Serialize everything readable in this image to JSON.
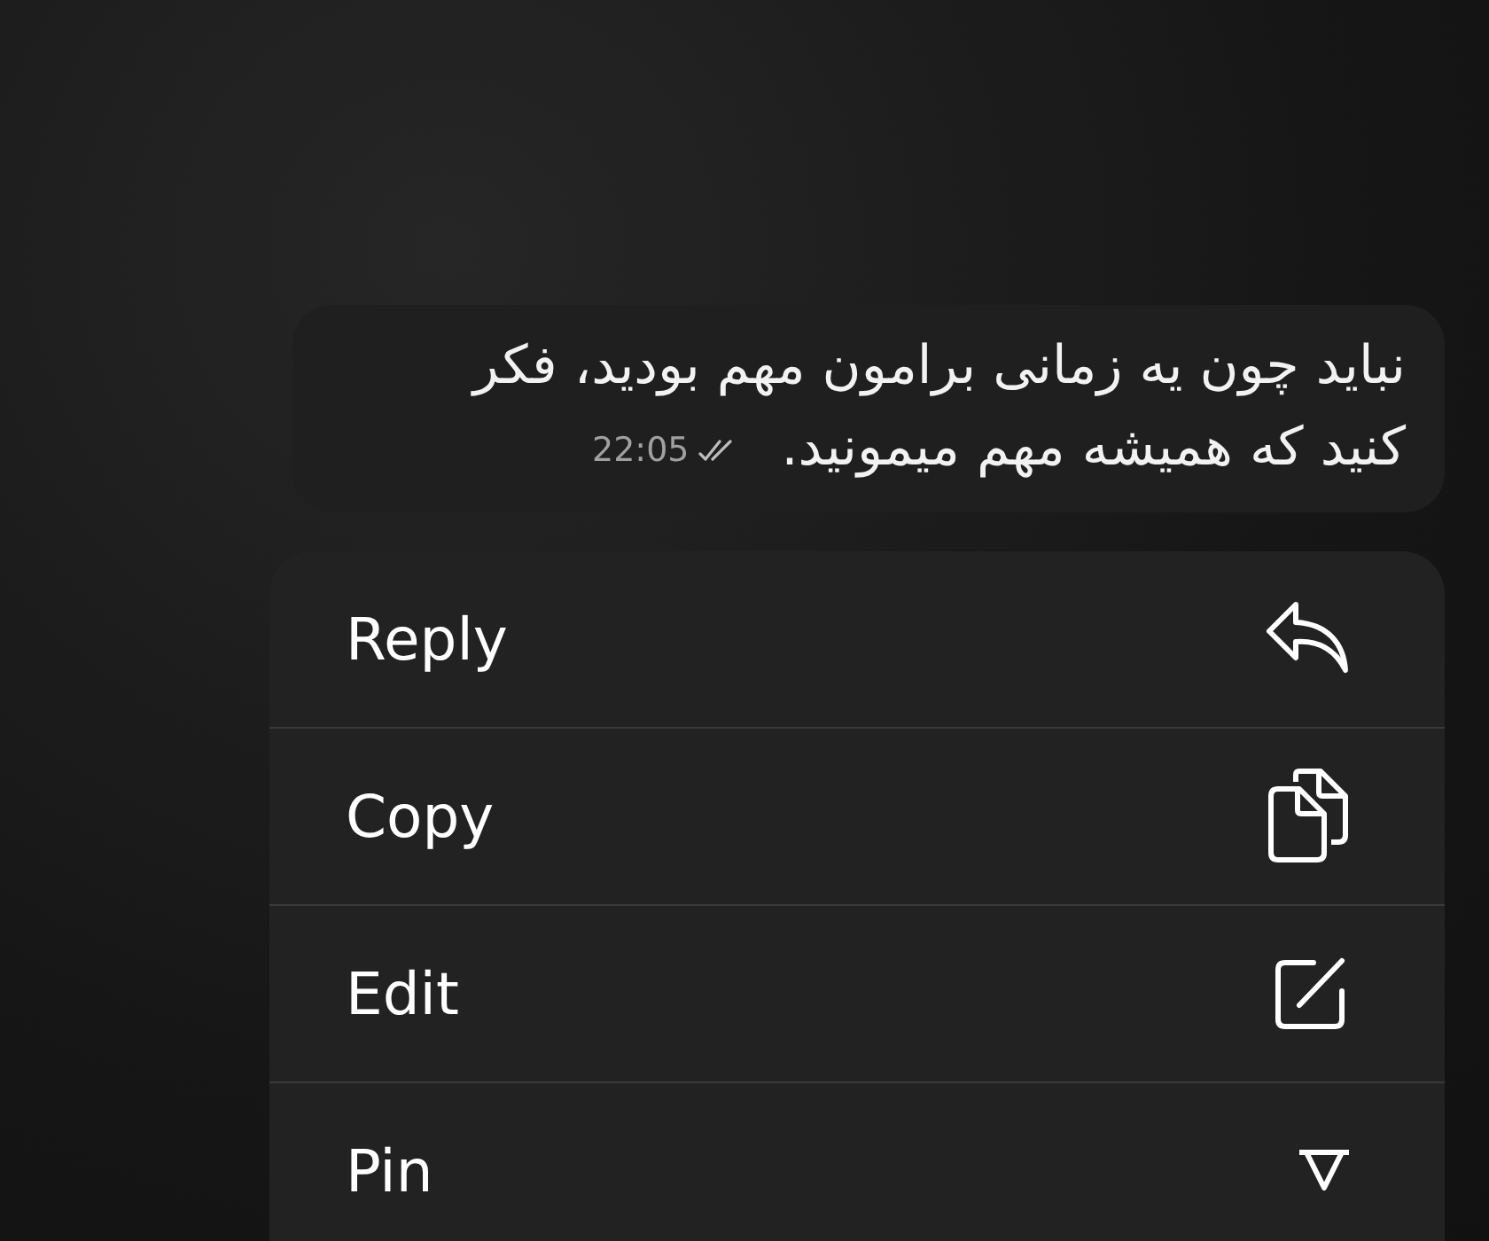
{
  "message": {
    "text": "نباید چون یه زمانی برامون مهم بودید، فکر کنید که همیشه مهم میمونید.",
    "time": "22:05",
    "read": true
  },
  "context_menu": [
    {
      "kind": "reply",
      "label": "Reply"
    },
    {
      "kind": "copy",
      "label": "Copy"
    },
    {
      "kind": "edit",
      "label": "Edit"
    },
    {
      "kind": "pin",
      "label": "Pin"
    }
  ]
}
